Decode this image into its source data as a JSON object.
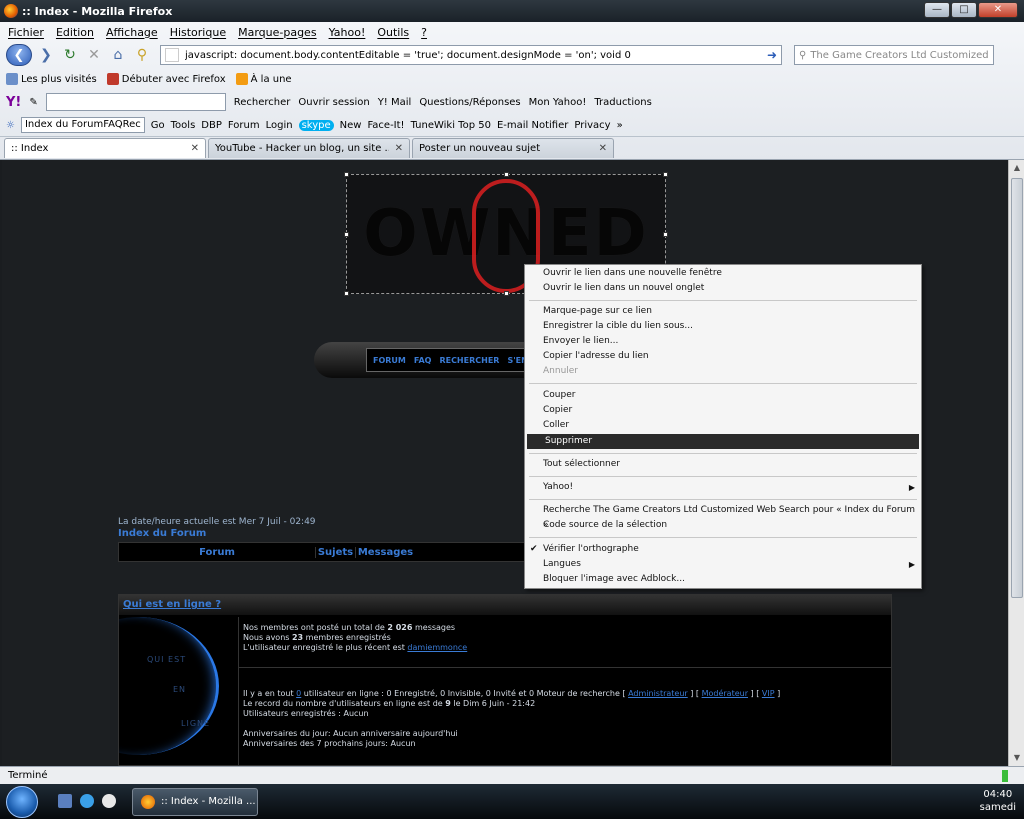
{
  "window": {
    "title": ":: Index - Mozilla Firefox"
  },
  "menubar": [
    "Fichier",
    "Edition",
    "Affichage",
    "Historique",
    "Marque-pages",
    "Yahoo!",
    "Outils",
    "?"
  ],
  "navbar": {
    "url": "javascript: document.body.contentEditable = 'true'; document.designMode = 'on'; void 0",
    "search_placeholder": "The Game Creators Ltd Customized"
  },
  "bookmarks": [
    "Les plus visités",
    "Débuter avec Firefox",
    "À la une"
  ],
  "yahoo_toolbar": [
    "Rechercher",
    "Ouvrir session",
    "Y! Mail",
    "Questions/Réponses",
    "Mon Yahoo!",
    "Traductions"
  ],
  "toolbar2": {
    "select": "Index du ForumFAQRec",
    "items": [
      "Go",
      "Tools",
      "DBP",
      "Forum",
      "Login",
      "New",
      "Face-It!",
      "TuneWiki Top 50",
      "E-mail Notifier",
      "Privacy",
      "»"
    ]
  },
  "tabs": [
    {
      "label": ":: Index"
    },
    {
      "label": "YouTube - Hacker un blog, un site ..."
    },
    {
      "label": "Poster un nouveau sujet"
    }
  ],
  "page": {
    "banner_text": "OWNED",
    "nav_links": [
      "FORUM",
      "FAQ",
      "RECHERCHER",
      "S'EN"
    ],
    "date_line": "La date/heure actuelle est Mer 7 Juil - 02:49",
    "index_link": "Index du Forum",
    "forum_headers": [
      "Forum",
      "Sujets",
      "Messages"
    ],
    "online": {
      "title": "Qui est en ligne ?",
      "left_words": [
        "QUI  EST",
        "EN",
        "LIGNE"
      ],
      "stats_1": "Nos membres ont posté un total de ",
      "stats_1b": "2 026",
      "stats_1c": " messages",
      "stats_2": "Nous avons ",
      "stats_2b": "23",
      "stats_2c": " membres enregistrés",
      "stats_3": "L'utilisateur enregistré le plus récent est ",
      "stats_3b": "damiemmonce",
      "users_1": "Il y a en tout ",
      "users_1b": "0",
      "users_1c": " utilisateur en ligne : 0 Enregistré, 0 Invisible, 0 Invité et 0 Moteur de recherche   [ ",
      "users_1d": "Administrateur",
      "users_1e": " ]  [ ",
      "users_1f": "Modérateur",
      "users_1g": " ]  [ ",
      "users_1h": "VIP",
      "users_1i": " ]",
      "users_2": "Le record du nombre d'utilisateurs en ligne est de ",
      "users_2b": "9",
      "users_2c": " le Dim 6 Juin - 21:42",
      "users_3": "Utilisateurs enregistrés : Aucun",
      "users_4": "Anniversaires du jour: Aucun anniversaire aujourd'hui",
      "users_5": "Anniversaires des 7 prochains jours: Aucun"
    }
  },
  "context_menu": [
    "Ouvrir le lien dans une nouvelle fenêtre",
    "Ouvrir le lien dans un nouvel onglet",
    "Marque-page sur ce lien",
    "Enregistrer la cible du lien sous...",
    "Envoyer le lien...",
    "Copier l'adresse du lien",
    "Annuler",
    "Couper",
    "Copier",
    "Coller",
    "Supprimer",
    "Tout sélectionner",
    "Yahoo!",
    "Recherche The Game Creators Ltd Customized Web Search pour « Index du Forum »",
    "Code source de la sélection",
    "Vérifier l'orthographe",
    "Langues",
    "Bloquer l'image avec Adblock..."
  ],
  "status": "Terminé",
  "taskbar": {
    "button": ":: Index - Mozilla ...",
    "time": "04:40",
    "day": "samedi"
  },
  "colors": {
    "accent": "#3a7bd5",
    "skull": "#d01f1f",
    "menu_highlight": "#2a2a2a"
  }
}
